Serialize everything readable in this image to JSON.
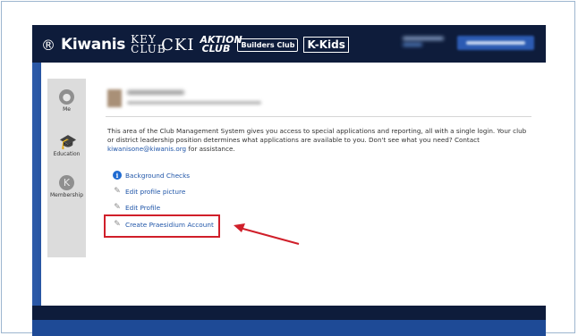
{
  "brand": {
    "kiwanis": "Kiwanis",
    "key_club": "KEY CLUB",
    "cki": "CKI",
    "aktion_club": "AKTION CLUB",
    "builders_club": "Builders Club",
    "kkids": "K-Kids"
  },
  "sidebar": {
    "items": [
      {
        "label": "Me",
        "icon": "person-icon"
      },
      {
        "label": "Education",
        "icon": "graduation-cap-icon"
      },
      {
        "label": "Membership",
        "icon": "kiwanis-logo-icon"
      }
    ]
  },
  "main": {
    "description_1": "This area of the Club Management System gives you access to special applications and reporting, all with a single login. Your club or district leadership position determines what applications are available to you. Don't see what you need? Contact ",
    "contact_email": "kiwanisone@kiwanis.org",
    "description_2": " for assistance.",
    "links": [
      {
        "label": "Background Checks",
        "icon": "info-icon"
      },
      {
        "label": "Edit profile picture",
        "icon": "pencil-icon"
      },
      {
        "label": "Edit Profile",
        "icon": "pencil-icon"
      },
      {
        "label": "Create Praesidium Account",
        "icon": "pencil-icon"
      }
    ]
  },
  "colors": {
    "header": "#0e1c3b",
    "frame_blue": "#1e4a96",
    "link": "#1f55a8",
    "highlight": "#d01f2a",
    "sidebar": "#dcdcdc"
  }
}
